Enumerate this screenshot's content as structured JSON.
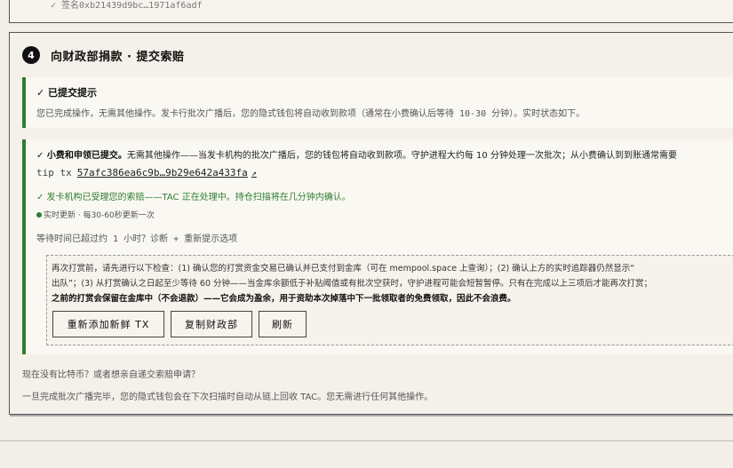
{
  "top": {
    "signature": "✓ 签名0xb21439d9bc…1971af6adf"
  },
  "step": {
    "number": "4",
    "title": "向财政部捐款 · 提交索赔"
  },
  "notice": {
    "title": "✓ 已提交提示",
    "body": "您已完成操作，无需其他操作。发卡行批次广播后，您的隐式钱包将自动收到款项（通常在小费确认后等待 10-30 分钟）。实时状态如下。"
  },
  "status": {
    "headline_bold": "✓ 小费和申领已提交。",
    "headline_rest": "无需其他操作——当发卡机构的批次广播后，您的钱包将自动收到款项。守护进程大约每 10 分钟处理一次批次；从小费确认到到账通常需要",
    "tip_label": "tip tx",
    "tip_hash": "57afc386ea6c9b…9b29e642a433fa",
    "tip_icon": "↗",
    "green_message": "✓ 发卡机构已受理您的索赔——TAC 正在处理中。持仓扫描将在几分钟内确认。",
    "live_label": "实时更新 · 每30-60秒更新一次",
    "wait_text": "等待时间已超过约 1 小时？诊断 + 重新提示选项",
    "check_line1": "再次打赏前，请先进行以下检查：(1) 确认您的打赏资金交易已确认并已支付到金库（可在 mempool.space 上查询）；(2) 确认上方的实时追踪器仍然显示“",
    "check_line2": "出队”；(3) 从打赏确认之日起至少等待 60 分钟——当金库余额低于补贴阈值或有批次空获时，守护进程可能会短暂暂停。只有在完成以上三项后才能再次打赏；",
    "check_line3": "之前的打赏会保留在金库中（不会退款）——它会成为盈余，用于资助本次掉落中下一批领取者的免费领取，因此不会浪费。",
    "buttons": {
      "readd": "重新添加新鲜 TX",
      "copy": "复制财政部",
      "refresh": "刷新"
    }
  },
  "footer": {
    "line1": "现在没有比特币？或者想亲自递交索赔申请？",
    "line2": "一旦完成批次广播完毕，您的隐式钱包会在下次扫描时自动从链上回收 TAC。您无需进行任何其他操作。"
  },
  "colors": {
    "accent_green": "#2e7d32",
    "background": "#f2efe8"
  }
}
